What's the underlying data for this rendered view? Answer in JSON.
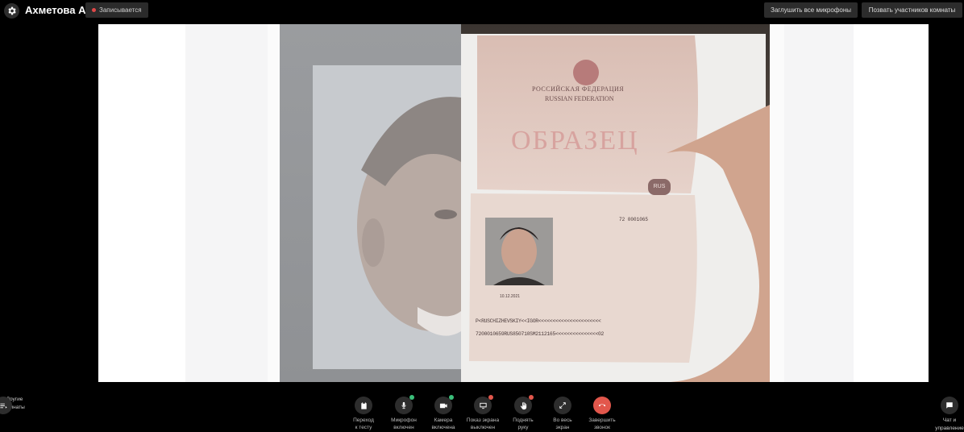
{
  "header": {
    "user_name": "Ахметова А.",
    "recording_label": "Записывается",
    "mute_all_label": "Заглушить все микрофоны",
    "invite_label": "Позвать участников комнаты",
    "recording_color": "#e04848"
  },
  "stage": {
    "document_text": {
      "line1": "РОССИЙСКАЯ ФЕДЕРАЦИЯ",
      "line2": "RUSSIAN FEDERATION",
      "stamp": "ОБРАЗЕЦ",
      "country_code": "RUS",
      "doc_number": "72 0001065",
      "date": "10.12.2021",
      "mrz1": "P<RUSCHIZHEVSKIY<<IGOR<<<<<<<<<<<<<<<<<<<<<<",
      "mrz2": "7200010659RUS850710SM2112165<<<<<<<<<<<<<<<02"
    }
  },
  "controls": {
    "other_rooms": "Другие\nкомнаты",
    "go_to_test": "Переход\nк тесту",
    "mic": "Микрофон\nвключен",
    "camera": "Камера\nвключена",
    "screen_share": "Показ экрана\nвыключен",
    "raise_hand": "Поднять\nруку",
    "fullscreen": "Во весь\nэкран",
    "end_call": "Завершить\nзвонок",
    "chat": "Чат и\nуправление",
    "status_on_color": "#3bbf7a",
    "status_off_color": "#e2574c",
    "end_call_color": "#e2574c"
  }
}
